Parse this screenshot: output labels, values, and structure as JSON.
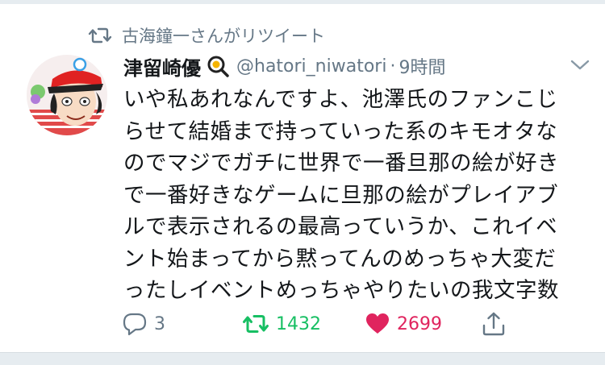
{
  "retweet_context": {
    "text": "古海鐘一さんがリツイート",
    "icon": "retweet-icon"
  },
  "tweet": {
    "display_name": "津留崎優",
    "name_emoji": "magnifier-emoji",
    "handle": "@hatori_niwatori",
    "separator": "·",
    "time": "9時間",
    "body_lines": [
      "いや私あれなんですよ、池澤氏のファンこじ",
      "らせて結婚まで持っていった系のキモオタな",
      "のでマジでガチに世界で一番旦那の絵が好き",
      "で一番好きなゲームに旦那の絵がプレイアブ",
      "ルで表示されるの最高っていうか、これイベ",
      "ント始まってから黙ってんのめっちゃ大変だ",
      "ったしイベントめっちゃやりたいの我文字数"
    ]
  },
  "actions": {
    "reply_count": "3",
    "retweet_count": "1432",
    "like_count": "2699"
  },
  "colors": {
    "text": "#14171a",
    "secondary": "#657786",
    "retweet_green": "#17bf63",
    "like_red": "#e0245e"
  }
}
